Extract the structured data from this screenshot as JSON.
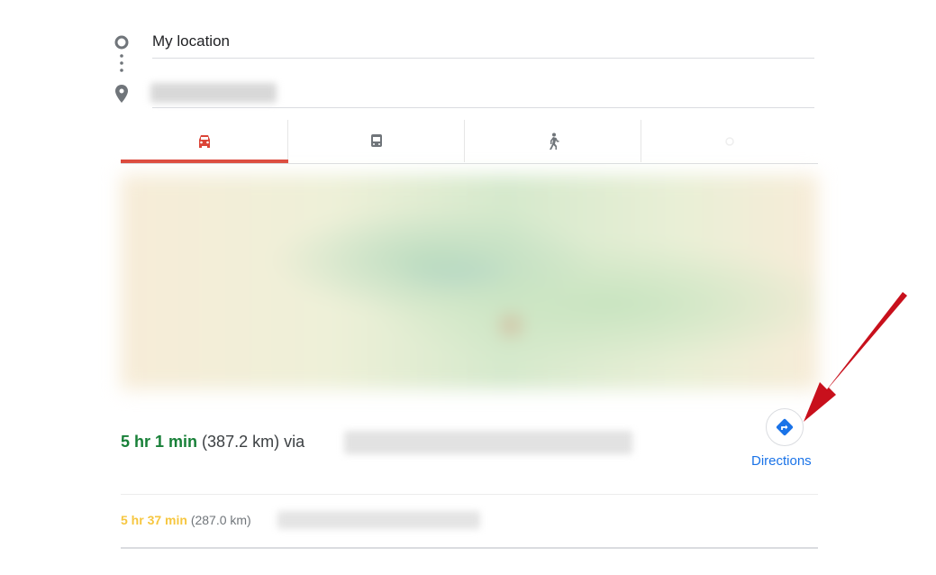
{
  "origin": {
    "value": "My location"
  },
  "destination": {
    "value": ""
  },
  "modes": [
    {
      "name": "driving",
      "active": true
    },
    {
      "name": "transit",
      "active": false
    },
    {
      "name": "walking",
      "active": false
    },
    {
      "name": "cycling",
      "active": false
    }
  ],
  "colors": {
    "accent": "#db4437",
    "fast": "#188038",
    "slow": "#f4b400",
    "link": "#1a73e8"
  },
  "routes": [
    {
      "duration": "5 hr 1 min",
      "distance": "(387.2 km)",
      "via": "via"
    },
    {
      "duration": "5 hr 37 min",
      "distance": "(287.0 km)"
    }
  ],
  "directions_label": "Directions"
}
